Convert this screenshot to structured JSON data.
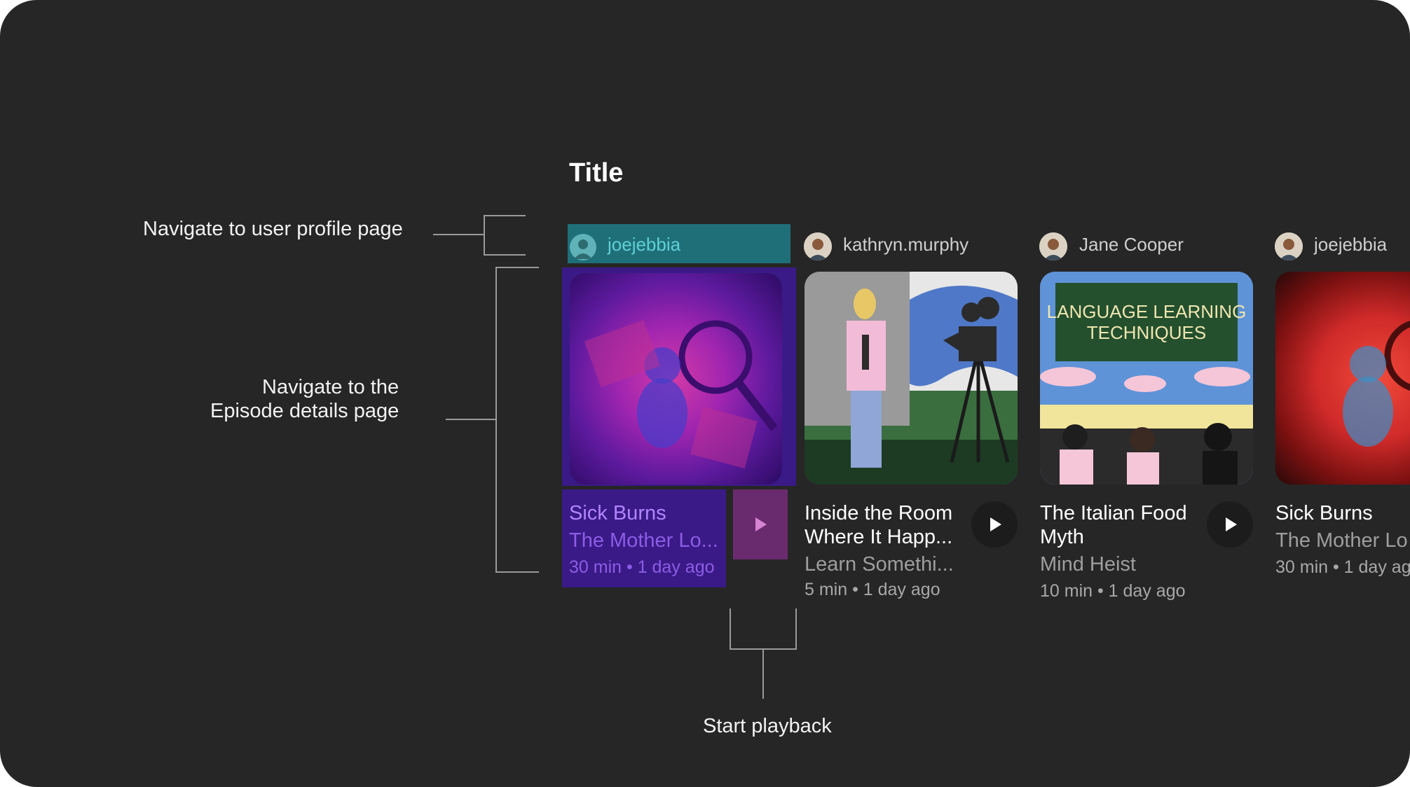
{
  "section": {
    "title": "Title"
  },
  "annotations": {
    "profile": "Navigate to user profile page",
    "episode_line1": "Navigate to the",
    "episode_line2": "Episode details page",
    "playback": "Start playback"
  },
  "cards": [
    {
      "user": "joejebbia",
      "title_line1": "Sick Burns",
      "title_line2": "",
      "show": "The Mother Lo...",
      "meta": "30 min • 1 day ago",
      "focused": true
    },
    {
      "user": "kathryn.murphy",
      "title_line1": "Inside the Room",
      "title_line2": "Where It Happ...",
      "show": "Learn Somethi...",
      "meta": "5 min • 1 day ago",
      "focused": false
    },
    {
      "user": "Jane Cooper",
      "title_line1": "The Italian Food",
      "title_line2": "Myth",
      "show": "Mind Heist",
      "meta": "10 min • 1 day ago",
      "focused": false,
      "art_text_line1": "LANGUAGE LEARNING",
      "art_text_line2": "TECHNIQUES"
    },
    {
      "user": "joejebbia",
      "title_line1": "Sick Burns",
      "title_line2": "",
      "show": "The Mother Lo",
      "meta": "30 min • 1 day ag",
      "focused": false
    }
  ],
  "colors": {
    "background": "#262626",
    "focus_teal": "#1f6f78",
    "focus_purple": "#3a1a86",
    "focus_play": "#6a2b6e",
    "focus_text": "#b184ff"
  },
  "icons": {
    "play": "play-icon",
    "avatar": "avatar-icon"
  }
}
